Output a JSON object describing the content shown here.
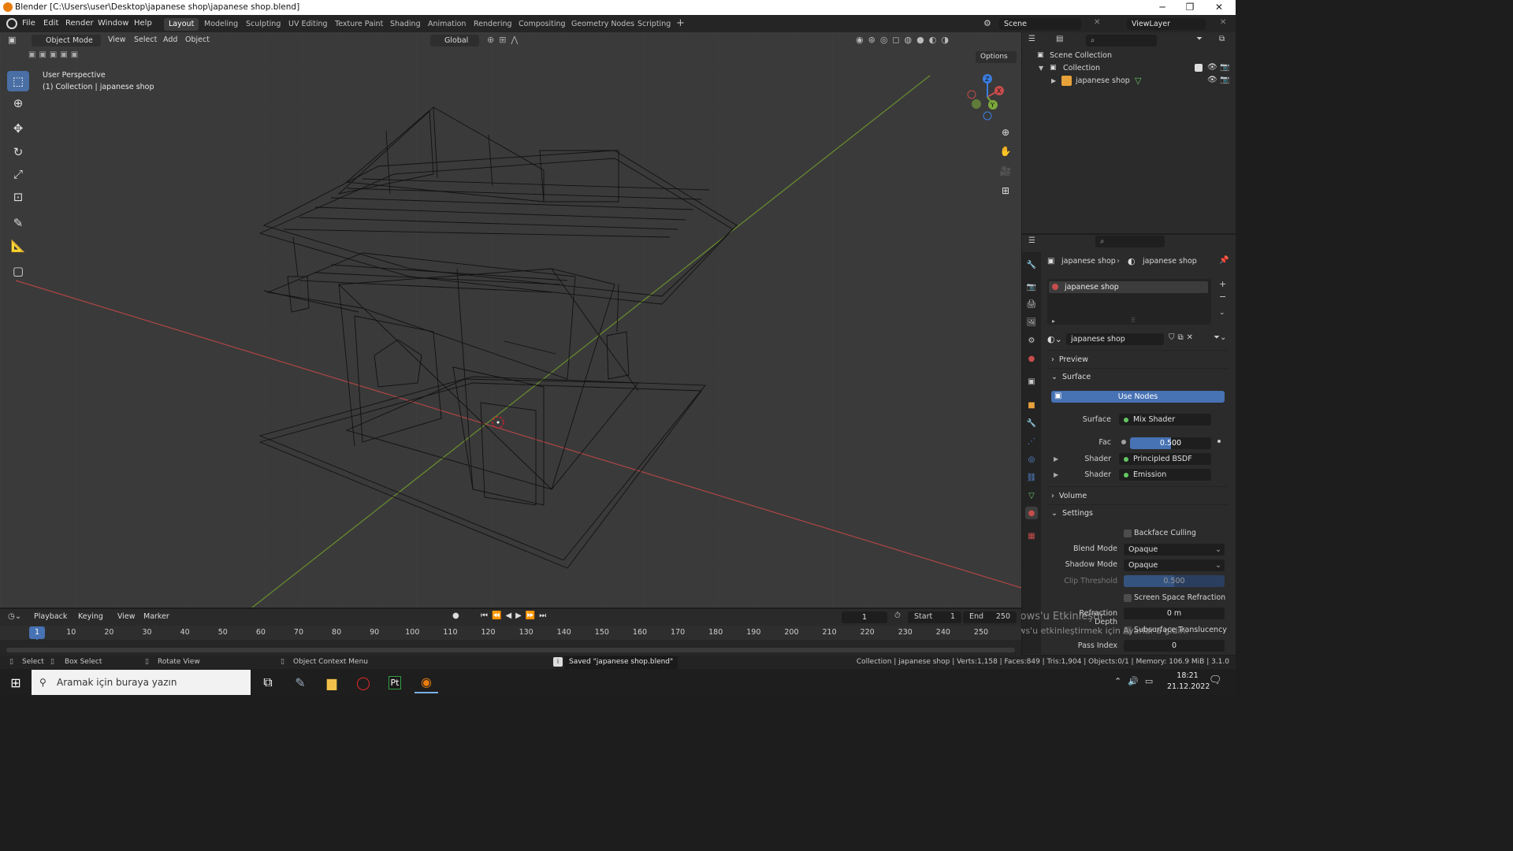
{
  "window": {
    "title": "Blender [C:\\Users\\user\\Desktop\\japanese shop\\japanese shop.blend]",
    "minimize": "─",
    "maximize": "❐",
    "close": "✕"
  },
  "menubar": {
    "items": [
      "File",
      "Edit",
      "Render",
      "Window",
      "Help"
    ]
  },
  "workspaces": [
    "Layout",
    "Modeling",
    "Sculpting",
    "UV Editing",
    "Texture Paint",
    "Shading",
    "Animation",
    "Rendering",
    "Compositing",
    "Geometry Nodes",
    "Scripting"
  ],
  "scene": {
    "label": "Scene",
    "viewlayer": "ViewLayer"
  },
  "viewport_header": {
    "mode": "Object Mode",
    "menus": [
      "View",
      "Select",
      "Add",
      "Object"
    ],
    "transform": "Global",
    "options": "Options"
  },
  "viewport_overlay": {
    "perspective": "User Perspective",
    "collection": "(1) Collection | japanese shop"
  },
  "gizmo": {
    "x": "X",
    "y": "Y",
    "z": "Z"
  },
  "outliner": {
    "root": "Scene Collection",
    "collection": "Collection",
    "object": "japanese shop"
  },
  "properties": {
    "breadcrumb_object": "japanese shop",
    "breadcrumb_material": "japanese shop",
    "slot": "japanese shop",
    "material_name": "japanese shop",
    "sections": {
      "preview": "Preview",
      "surface": "Surface",
      "volume": "Volume",
      "settings": "Settings"
    },
    "use_nodes": "Use Nodes",
    "surface_label": "Surface",
    "surface_value": "Mix Shader",
    "fac_label": "Fac",
    "fac_value": "0.500",
    "fac_fraction": 0.5,
    "shader1_label": "Shader",
    "shader1_value": "Principled BSDF",
    "shader2_label": "Shader",
    "shader2_value": "Emission",
    "backface": "Backface Culling",
    "blend_label": "Blend Mode",
    "blend_value": "Opaque",
    "shadow_label": "Shadow Mode",
    "shadow_value": "Opaque",
    "clip_label": "Clip Threshold",
    "clip_value": "0.500",
    "ssr": "Screen Space Refraction",
    "refraction_label": "Refraction Depth",
    "refraction_value": "0 m",
    "subsurface": "Subsurface Translucency",
    "pass_label": "Pass Index",
    "pass_value": "0"
  },
  "watermark": {
    "line1": "Windows'u Etkinleştir",
    "line2": "Windows'u etkinleştirmek için Ayarlar'a gidin."
  },
  "timeline": {
    "menus": [
      "Playback",
      "Keying",
      "View",
      "Marker"
    ],
    "current_frame": "1",
    "start_label": "Start",
    "start_value": "1",
    "end_label": "End",
    "end_value": "250",
    "ticks": [
      "1",
      "10",
      "20",
      "30",
      "40",
      "50",
      "60",
      "70",
      "80",
      "90",
      "100",
      "110",
      "120",
      "130",
      "140",
      "150",
      "160",
      "170",
      "180",
      "190",
      "200",
      "210",
      "220",
      "230",
      "240",
      "250"
    ]
  },
  "statusbar": {
    "select": "Select",
    "box_select": "Box Select",
    "rotate": "Rotate View",
    "context": "Object Context Menu",
    "saved": "Saved \"japanese shop.blend\"",
    "stats": "Collection | japanese shop | Verts:1,158 | Faces:849 | Tris:1,904 | Objects:0/1 | Memory: 106.9 MiB | 3.1.0"
  },
  "taskbar": {
    "search_placeholder": "Aramak için buraya yazın",
    "time": "18:21",
    "date": "21.12.2022"
  },
  "colors": {
    "accent": "#4a6fa5",
    "x_axis": "#c74c4c",
    "y_axis": "#7aa83a",
    "selected": "#4772b3"
  }
}
